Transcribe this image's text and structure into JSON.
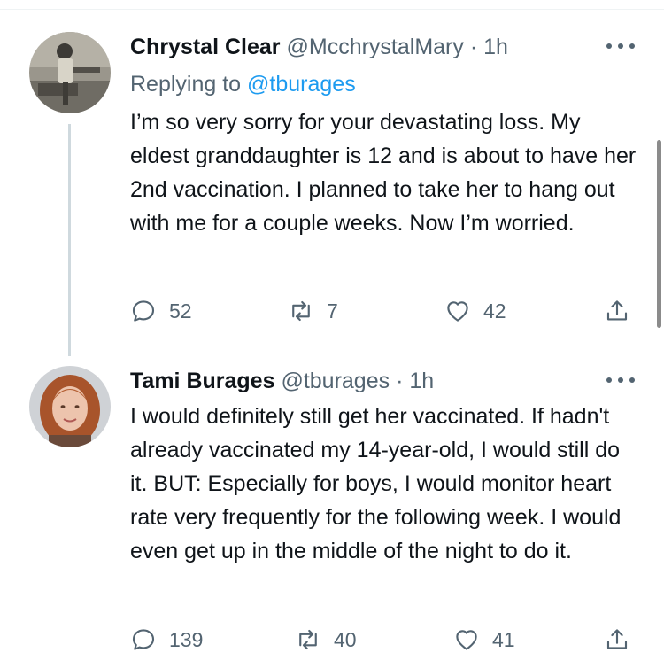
{
  "tweets": [
    {
      "name": "Chrystal Clear",
      "handle": "@McchrystalMary",
      "separator": "·",
      "time": "1h",
      "replying_prefix": "Replying to",
      "replying_mention": "@tburages",
      "text": "I’m so very sorry for your devastating loss. My eldest granddaughter is 12 and is about to have her 2nd vaccination. I planned to take her to hang out with me for a couple weeks. Now I’m worried.",
      "replies": "52",
      "retweets": "7",
      "likes": "42"
    },
    {
      "name": "Tami Burages",
      "handle": "@tburages",
      "separator": "·",
      "time": "1h",
      "text": "I would definitely still get her vaccinated. If hadn't already vaccinated my 14-year-old, I would still do it. BUT: Especially for boys, I would monitor heart rate very frequently for the following week. I would even get up in the middle of the night to do it.",
      "replies": "139",
      "retweets": "40",
      "likes": "41"
    }
  ],
  "icons": {
    "reply": "reply-icon",
    "retweet": "retweet-icon",
    "like": "heart-icon",
    "share": "share-icon",
    "more": "more-icon"
  },
  "colors": {
    "text": "#0f1419",
    "secondary": "#536471",
    "link": "#1d9bf0",
    "thread_line": "#cfd9de"
  }
}
